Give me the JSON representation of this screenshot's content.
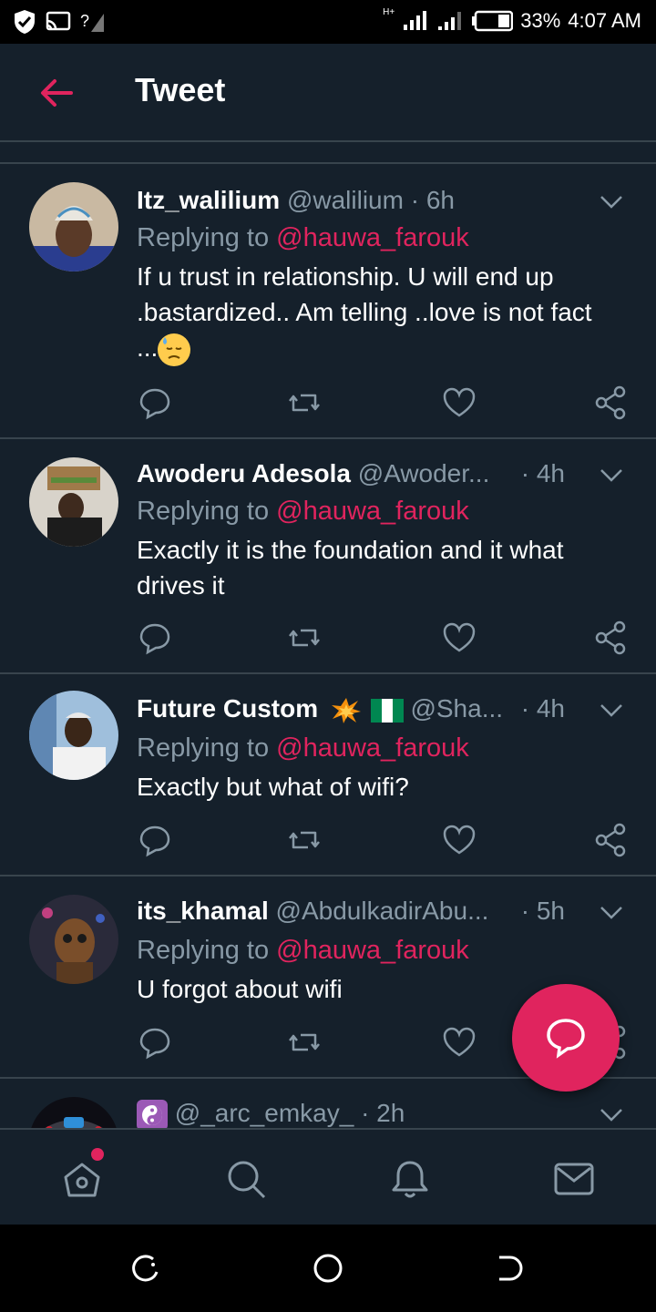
{
  "status_bar": {
    "battery": "33%",
    "time": "4:07 AM",
    "network_label": "H+",
    "icons": [
      "shield-check-icon",
      "cast-icon",
      "no-sim-icon",
      "signal-icon",
      "signal-icon-2",
      "battery-icon"
    ]
  },
  "header": {
    "title": "Tweet",
    "back_icon": "arrow-left-icon"
  },
  "tweets": [
    {
      "name": "Itz_walilium",
      "handle": "@walilium",
      "time": "· 6h",
      "replying_prefix": "Replying to",
      "replying_to": "@hauwa_farouk",
      "text": "If u trust in relationship. U will end up .bastardized.. Am telling ..love is not fact ...",
      "emoji": "downcast-face-with-sweat"
    },
    {
      "name": "Awoderu Adesola",
      "handle": "@Awoder...",
      "time": "· 4h",
      "replying_prefix": "Replying to",
      "replying_to": "@hauwa_farouk",
      "text": "Exactly it is the foundation and it what drives it"
    },
    {
      "name": "Future Custom",
      "name_emojis": [
        "collision",
        "flag-nigeria"
      ],
      "handle": "@Sha...",
      "time": "· 4h",
      "replying_prefix": "Replying to",
      "replying_to": "@hauwa_farouk",
      "text": "Exactly but what of wifi?"
    },
    {
      "name": "its_khamal",
      "handle": "@AbdulkadirAbu...",
      "time": "· 5h",
      "replying_prefix": "Replying to",
      "replying_to": "@hauwa_farouk",
      "text": "U forgot about wifi"
    },
    {
      "name": "",
      "name_emojis": [
        "yin-yang"
      ],
      "handle": "@_arc_emkay_",
      "time": "· 2h"
    }
  ],
  "colors": {
    "background": "#15202b",
    "divider": "#38444d",
    "secondary_text": "#8899a6",
    "accent": "#e0245e"
  },
  "tabs": [
    "home-icon",
    "search-icon",
    "notifications-icon",
    "messages-icon"
  ],
  "fab_icon": "compose-reply-icon",
  "nav_buttons": [
    "recents-icon",
    "home-circle-icon",
    "back-nav-icon"
  ]
}
